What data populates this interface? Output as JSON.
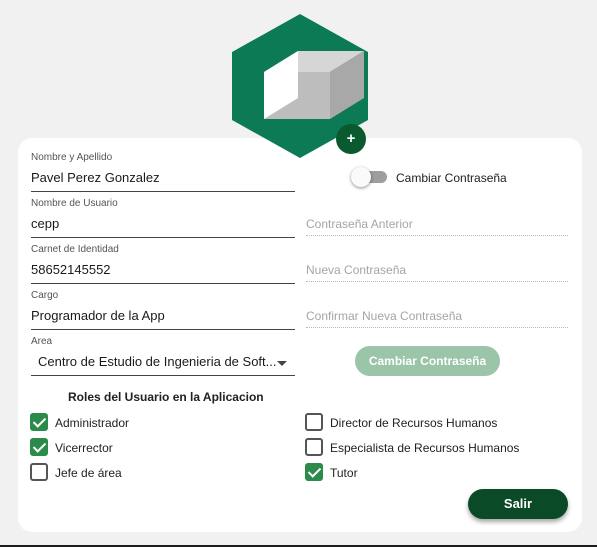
{
  "form": {
    "name_label": "Nombre y Apellido",
    "name_value": "Pavel Perez Gonzalez",
    "username_label": "Nombre de Usuario",
    "username_value": "cepp",
    "id_label": "Carnet de Identidad",
    "id_value": "58652145552",
    "position_label": "Cargo",
    "position_value": "Programador de la App",
    "area_label": "Area",
    "area_value": "Centro de Estudio de Ingenieria de Soft..."
  },
  "password": {
    "toggle_label": "Cambiar Contraseña",
    "old_placeholder": "Contraseña Anterior",
    "new_placeholder": "Nueva Contraseña",
    "confirm_placeholder": "Confirmar Nueva Contraseña",
    "button_label": "Cambiar Contraseña"
  },
  "avatar": {
    "add_label": "+"
  },
  "roles": {
    "title": "Roles del Usuario en la Aplicacion",
    "left": [
      {
        "label": "Administrador",
        "checked": true
      },
      {
        "label": "Vicerrector",
        "checked": true
      },
      {
        "label": "Jefe de área",
        "checked": false
      }
    ],
    "right": [
      {
        "label": "Director de Recursos Humanos",
        "checked": false
      },
      {
        "label": "Especialista de Recursos Humanos",
        "checked": false
      },
      {
        "label": "Tutor",
        "checked": true
      }
    ]
  },
  "actions": {
    "exit_label": "Salir"
  },
  "colors": {
    "brand_green": "#0b7a55",
    "dark_green": "#0b4a26",
    "check_green": "#2c8a4a"
  }
}
